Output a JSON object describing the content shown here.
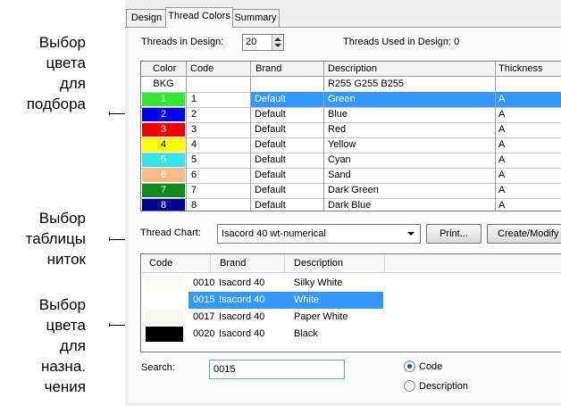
{
  "callouts": {
    "color_to_match": [
      "Выбор",
      "цвета",
      "для",
      "подбора"
    ],
    "thread_chart": [
      "Выбор",
      "таблицы",
      "ниток"
    ],
    "color_to_assign": [
      "Выбор",
      "цвета",
      "для",
      "назна.",
      "чения"
    ]
  },
  "tabs": [
    "Design",
    "Thread Colors",
    "Summary"
  ],
  "active_tab": "Thread Colors",
  "threads_in_design": {
    "label": "Threads in Design:",
    "value": "20"
  },
  "threads_used": "Threads Used in Design: 0",
  "grid": {
    "columns": [
      "Color",
      "Code",
      "Brand",
      "Description",
      "Thickness"
    ],
    "rows": [
      {
        "color_label": "BKG",
        "color": "#ffffff",
        "text_color": "#000000",
        "code": "",
        "brand": "",
        "description": "R255 G255 B255",
        "thickness": "",
        "selected": false
      },
      {
        "color_label": "1",
        "color": "#33e833",
        "text_color": "#ffffff",
        "code": "1",
        "brand": "Default",
        "description": "Green",
        "thickness": "A",
        "selected": true
      },
      {
        "color_label": "2",
        "color": "#0000ee",
        "text_color": "#ffffff",
        "code": "2",
        "brand": "Default",
        "description": "Blue",
        "thickness": "A",
        "selected": false
      },
      {
        "color_label": "3",
        "color": "#ee0000",
        "text_color": "#ffffff",
        "code": "3",
        "brand": "Default",
        "description": "Red",
        "thickness": "A",
        "selected": false
      },
      {
        "color_label": "4",
        "color": "#ffff00",
        "text_color": "#000000",
        "code": "4",
        "brand": "Default",
        "description": "Yellow",
        "thickness": "A",
        "selected": false
      },
      {
        "color_label": "5",
        "color": "#33e6e6",
        "text_color": "#ffffff",
        "code": "5",
        "brand": "Default",
        "description": "Cyan",
        "thickness": "A",
        "selected": false
      },
      {
        "color_label": "6",
        "color": "#f5bc86",
        "text_color": "#ffffff",
        "code": "6",
        "brand": "Default",
        "description": "Sand",
        "thickness": "A",
        "selected": false
      },
      {
        "color_label": "7",
        "color": "#108a1c",
        "text_color": "#ffffff",
        "code": "7",
        "brand": "Default",
        "description": "Dark Green",
        "thickness": "A",
        "selected": false
      },
      {
        "color_label": "8",
        "color": "#000090",
        "text_color": "#ffffff",
        "code": "8",
        "brand": "Default",
        "description": "Dark Blue",
        "thickness": "A",
        "selected": false
      }
    ]
  },
  "thread_chart": {
    "label": "Thread Chart:",
    "value": "Isacord 40 wt-numerical",
    "print_label": "Print...",
    "create_label": "Create/Modify"
  },
  "list": {
    "columns": [
      "Code",
      "Brand",
      "Description"
    ],
    "rows": [
      {
        "code": "0010",
        "brand": "Isacord 40",
        "description": "Silky White",
        "color": "#fbfbf6",
        "selected": false
      },
      {
        "code": "0015",
        "brand": "Isacord 40",
        "description": "White",
        "color": "#ffffff",
        "selected": true
      },
      {
        "code": "0017",
        "brand": "Isacord 40",
        "description": "Paper White",
        "color": "#f8f8f2",
        "selected": false
      },
      {
        "code": "0020",
        "brand": "Isacord 40",
        "description": "Black",
        "color": "#000000",
        "selected": false
      }
    ]
  },
  "search": {
    "label": "Search:",
    "value": "0015",
    "options": [
      "Code",
      "Description"
    ],
    "selected": "Code"
  },
  "colors": {
    "selection": "#3399ff",
    "panel": "#f0f0f0"
  }
}
